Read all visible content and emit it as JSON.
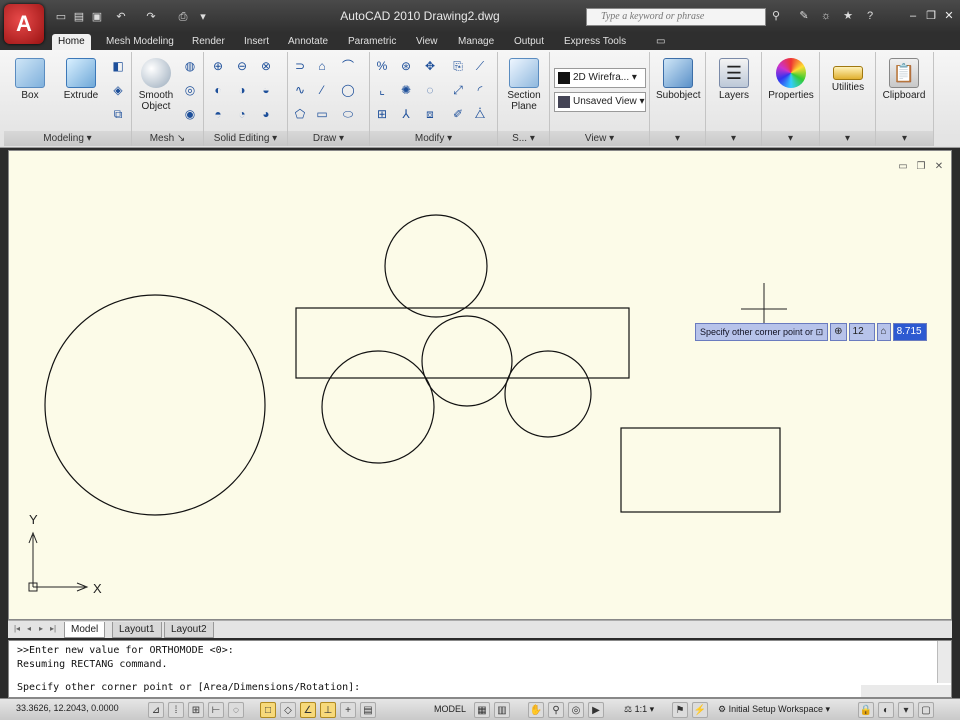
{
  "title_bar": {
    "title": "AutoCAD 2010    Drawing2.dwg",
    "search_placeholder": "Type a keyword or phrase",
    "app_letter": "A"
  },
  "ribbon_tabs": [
    "Home",
    "Mesh Modeling",
    "Render",
    "Insert",
    "Annotate",
    "Parametric",
    "View",
    "Manage",
    "Output",
    "Express Tools"
  ],
  "ribbon": {
    "modeling": {
      "label": "Modeling",
      "box": "Box",
      "extrude": "Extrude"
    },
    "mesh": {
      "label": "Mesh",
      "smooth_object": "Smooth Object"
    },
    "solid_editing": {
      "label": "Solid Editing"
    },
    "draw": {
      "label": "Draw"
    },
    "modify": {
      "label": "Modify"
    },
    "section": {
      "label": "S...",
      "section_plane": "Section Plane"
    },
    "view": {
      "label": "View",
      "visual_style": "2D Wirefra...",
      "named_view": "Unsaved View"
    },
    "subobject": {
      "label": "Subobject"
    },
    "layers": {
      "label": "Layers"
    },
    "properties": {
      "label": "Properties"
    },
    "utilities": {
      "label": "Utilities"
    },
    "clipboard": {
      "label": "Clipboard"
    }
  },
  "viewport": {
    "ucs_y": "Y",
    "ucs_x": "X"
  },
  "dynamic_input": {
    "prompt": "Specify other corner point or",
    "value1": "12",
    "value2": "8.715"
  },
  "layout_tabs": [
    "Model",
    "Layout1",
    "Layout2"
  ],
  "command_line": {
    "history": [
      ">>Enter new value for ORTHOMODE <0>:",
      "Resuming RECTANG command."
    ],
    "current": "Specify other corner point or [Area/Dimensions/Rotation]:"
  },
  "status_bar": {
    "coordinates": "33.3626, 12.2043, 0.0000",
    "model": "MODEL",
    "scale": "1:1",
    "workspace": "Initial Setup Workspace"
  },
  "colors": {
    "viewport_bg": "#fcfbe8",
    "title_bg": "#3a3a3a",
    "dyn_selected": "#2d5ad1"
  }
}
